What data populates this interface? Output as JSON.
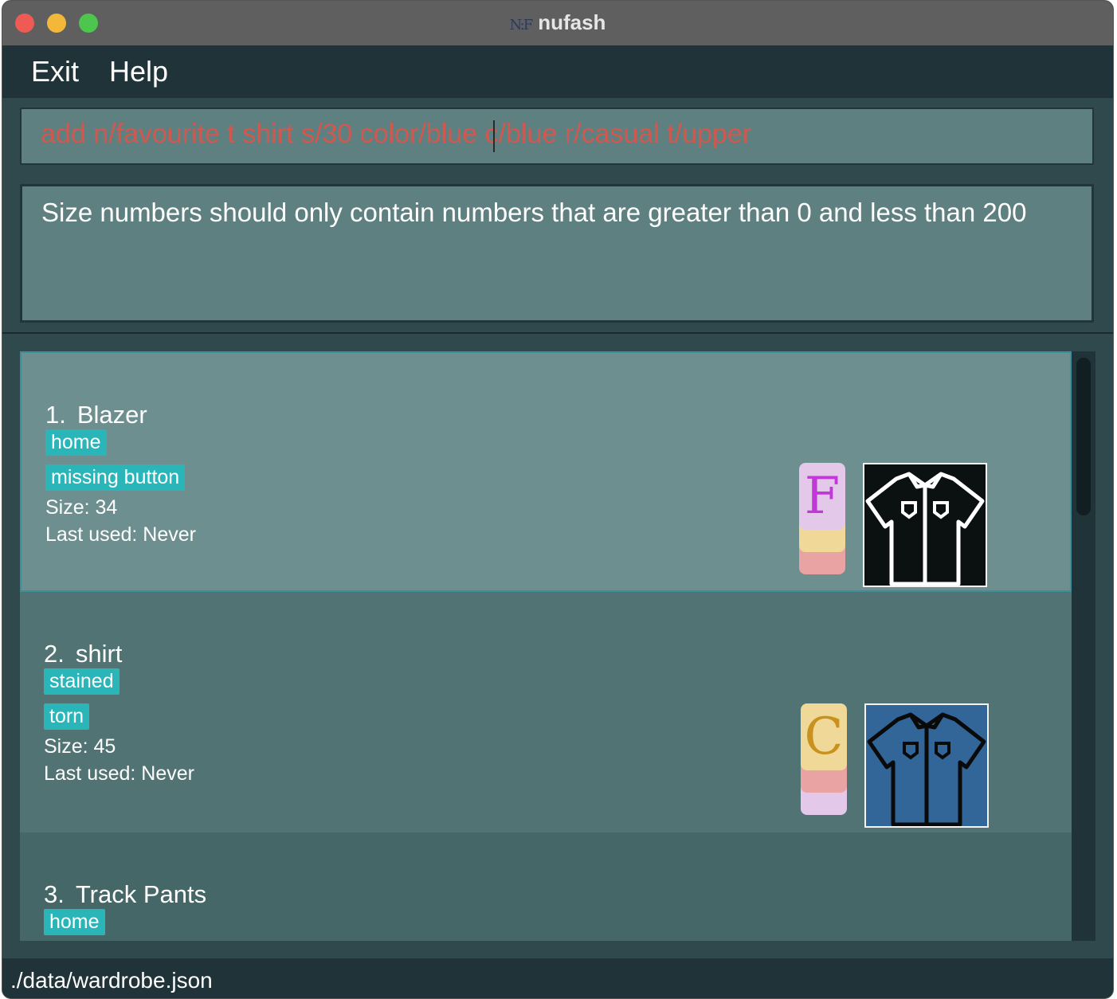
{
  "window": {
    "title": "nufash",
    "logo_text": "N:F"
  },
  "menu": {
    "exit_label": "Exit",
    "help_label": "Help"
  },
  "command": {
    "value": "add n/favourite t shirt s/30  color/blue c/blue r/casual t/upper"
  },
  "result": {
    "message": "Size numbers should only contain numbers that are greater than 0 and less than 200"
  },
  "items": [
    {
      "index": "1.",
      "name": "Blazer",
      "tags": [
        "home",
        "missing button"
      ],
      "size": "Size: 34",
      "last_used": "Last used: Never",
      "badge_letter": "F",
      "thumb_color": "#0b1010"
    },
    {
      "index": "2.",
      "name": "shirt",
      "tags": [
        "stained",
        "torn"
      ],
      "size": "Size: 45",
      "last_used": "Last used: Never",
      "badge_letter": "C",
      "thumb_color": "#326699"
    },
    {
      "index": "3.",
      "name": "Track Pants",
      "tags": [
        "home"
      ]
    }
  ],
  "status": {
    "path": "./data/wardrobe.json"
  },
  "colors": {
    "error_text": "#d1584f",
    "tag_bg": "#2ab6b9",
    "badge_purple": "#e3c8ea",
    "badge_yellow": "#f0d998",
    "badge_pink": "#eaa3a3"
  },
  "icons": [
    "close-light-icon",
    "minimize-light-icon",
    "zoom-light-icon",
    "shirt-icon"
  ]
}
